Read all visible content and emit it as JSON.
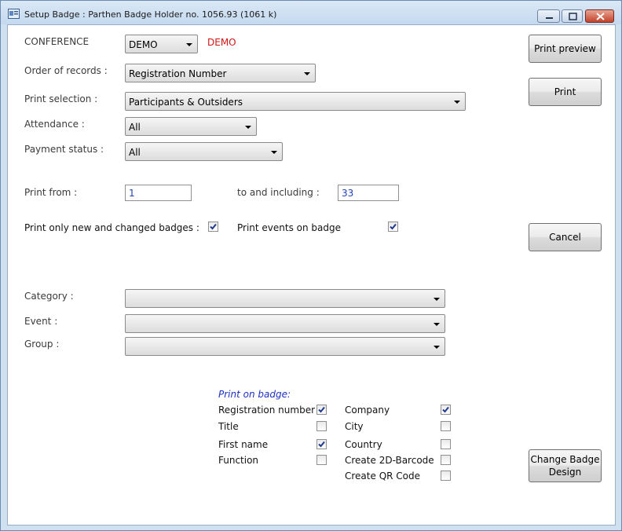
{
  "window": {
    "title": "Setup Badge : Parthen Badge Holder no. 1056.93 (1061 k)"
  },
  "form": {
    "conference_label": "CONFERENCE",
    "conference_value": "DEMO",
    "conference_name": "DEMO",
    "order_label": "Order of records :",
    "order_value": "Registration Number",
    "print_selection_label": "Print selection :",
    "print_selection_value": "Participants & Outsiders",
    "attendance_label": "Attendance :",
    "attendance_value": "All",
    "payment_label": "Payment status :",
    "payment_value": "All",
    "print_from_label": "Print from :",
    "print_from_value": "1",
    "to_including_label": "to and including :",
    "to_including_value": "33",
    "only_new_label": "Print only new and changed badges :",
    "only_new_checked": true,
    "events_label": "Print events on badge",
    "events_checked": true,
    "category_label": "Category :",
    "category_value": "",
    "event_label": "Event :",
    "event_value": "",
    "group_label": "Group :",
    "group_value": ""
  },
  "print_on_badge": {
    "title": "Print on badge:",
    "left": [
      {
        "label": "Registration number",
        "checked": true
      },
      {
        "label": "Title",
        "checked": false
      },
      {
        "label": "First name",
        "checked": true
      },
      {
        "label": "Function",
        "checked": false
      }
    ],
    "right": [
      {
        "label": "Company",
        "checked": true
      },
      {
        "label": "City",
        "checked": false
      },
      {
        "label": "Country",
        "checked": false
      },
      {
        "label": "Create 2D-Barcode",
        "checked": false
      },
      {
        "label": "Create QR Code",
        "checked": false
      }
    ]
  },
  "buttons": {
    "print_preview": "Print preview",
    "print": "Print",
    "cancel": "Cancel",
    "change_design_1": "Change Badge",
    "change_design_2": "Design"
  },
  "colors": {
    "accent_red": "#d31414",
    "value_blue": "#1f3fb6",
    "section_blue": "#1d2fc4"
  }
}
